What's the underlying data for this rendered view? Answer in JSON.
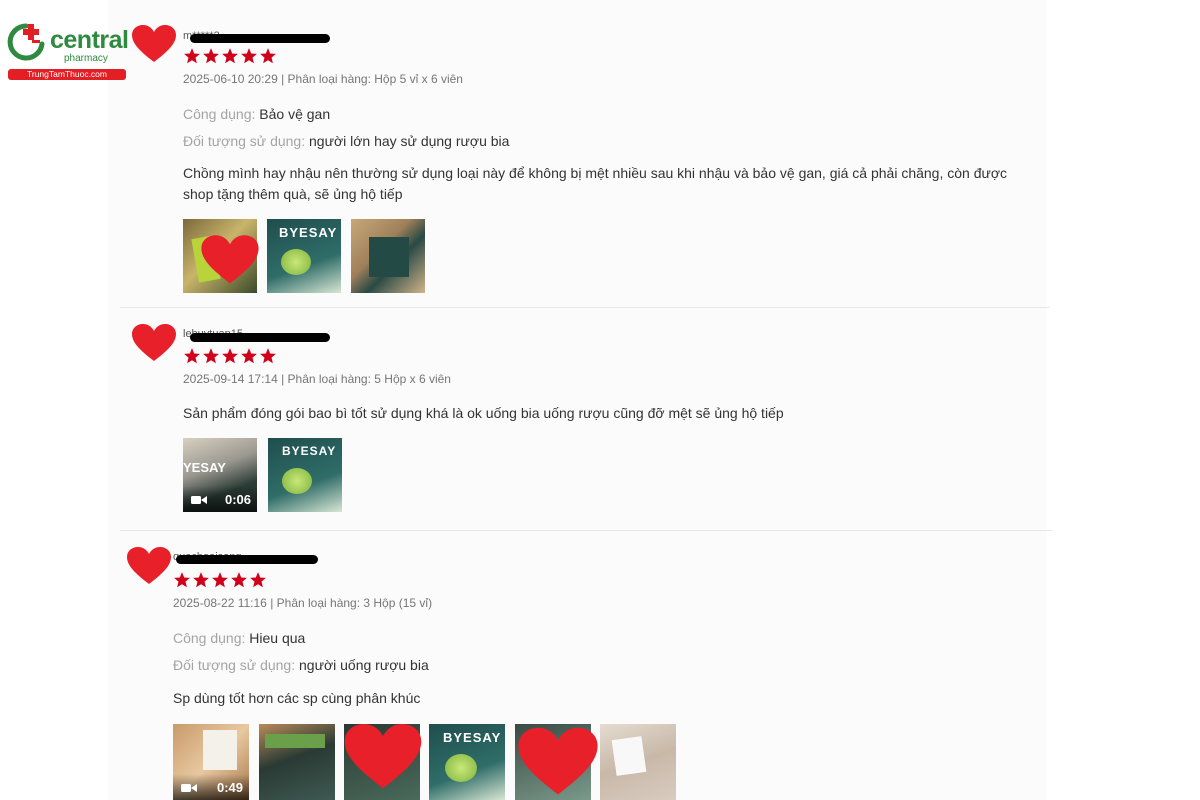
{
  "logo": {
    "brand": "central",
    "sub": "pharmacy",
    "site": "TrungTamThuoc.com"
  },
  "colors": {
    "star": "#d0021b",
    "heart": "#e8202a",
    "brand_green": "#2d8a3e",
    "brand_red": "#e31e24"
  },
  "reviews": [
    {
      "username": "m*****2",
      "rating": 5,
      "meta": "2025-06-10 20:29 | Phân loại hàng: Hộp 5 vỉ x 6 viên",
      "attrs": [
        {
          "key": "Công dụng: ",
          "value": "Bảo vệ gan"
        },
        {
          "key": "Đối tượng sử dụng: ",
          "value": "người lớn hay sử dụng rượu bia"
        }
      ],
      "comment": "Chồng mình hay nhậu nên thường sử dụng loại này để không bị mệt nhiều sau khi nhậu và bảo vệ gan, giá cả phải chăng, còn được shop tặng thêm quà, sẽ ủng hộ tiếp",
      "media": [
        {
          "type": "image"
        },
        {
          "type": "image",
          "label": "BYESAY"
        },
        {
          "type": "image"
        }
      ]
    },
    {
      "username": "lehuytuan15",
      "rating": 5,
      "meta": "2025-09-14 17:14 | Phân loại hàng: 5 Hộp x 6 viên",
      "attrs": [],
      "comment": "Sản phẩm đóng gói bao bì tốt sử dụng khá là ok uống bia uống rượu cũng đỡ mệt sẽ ủng hộ tiếp",
      "media": [
        {
          "type": "video",
          "duration": "0:06",
          "label": "YESAY"
        },
        {
          "type": "image",
          "label": "BYESAY"
        }
      ]
    },
    {
      "username": "quochoaisong",
      "rating": 5,
      "meta": "2025-08-22 11:16 | Phân loại hàng: 3 Hộp (15 vỉ)",
      "attrs": [
        {
          "key": "Công dụng: ",
          "value": "Hieu qua"
        },
        {
          "key": "Đối tượng sử dụng: ",
          "value": "người uống rượu bia"
        }
      ],
      "comment": "Sp dùng tốt hơn các sp cùng phân khúc",
      "media": [
        {
          "type": "video",
          "duration": "0:49"
        },
        {
          "type": "image"
        },
        {
          "type": "image"
        },
        {
          "type": "image",
          "label": "BYESAY"
        },
        {
          "type": "image"
        },
        {
          "type": "image"
        }
      ]
    }
  ]
}
